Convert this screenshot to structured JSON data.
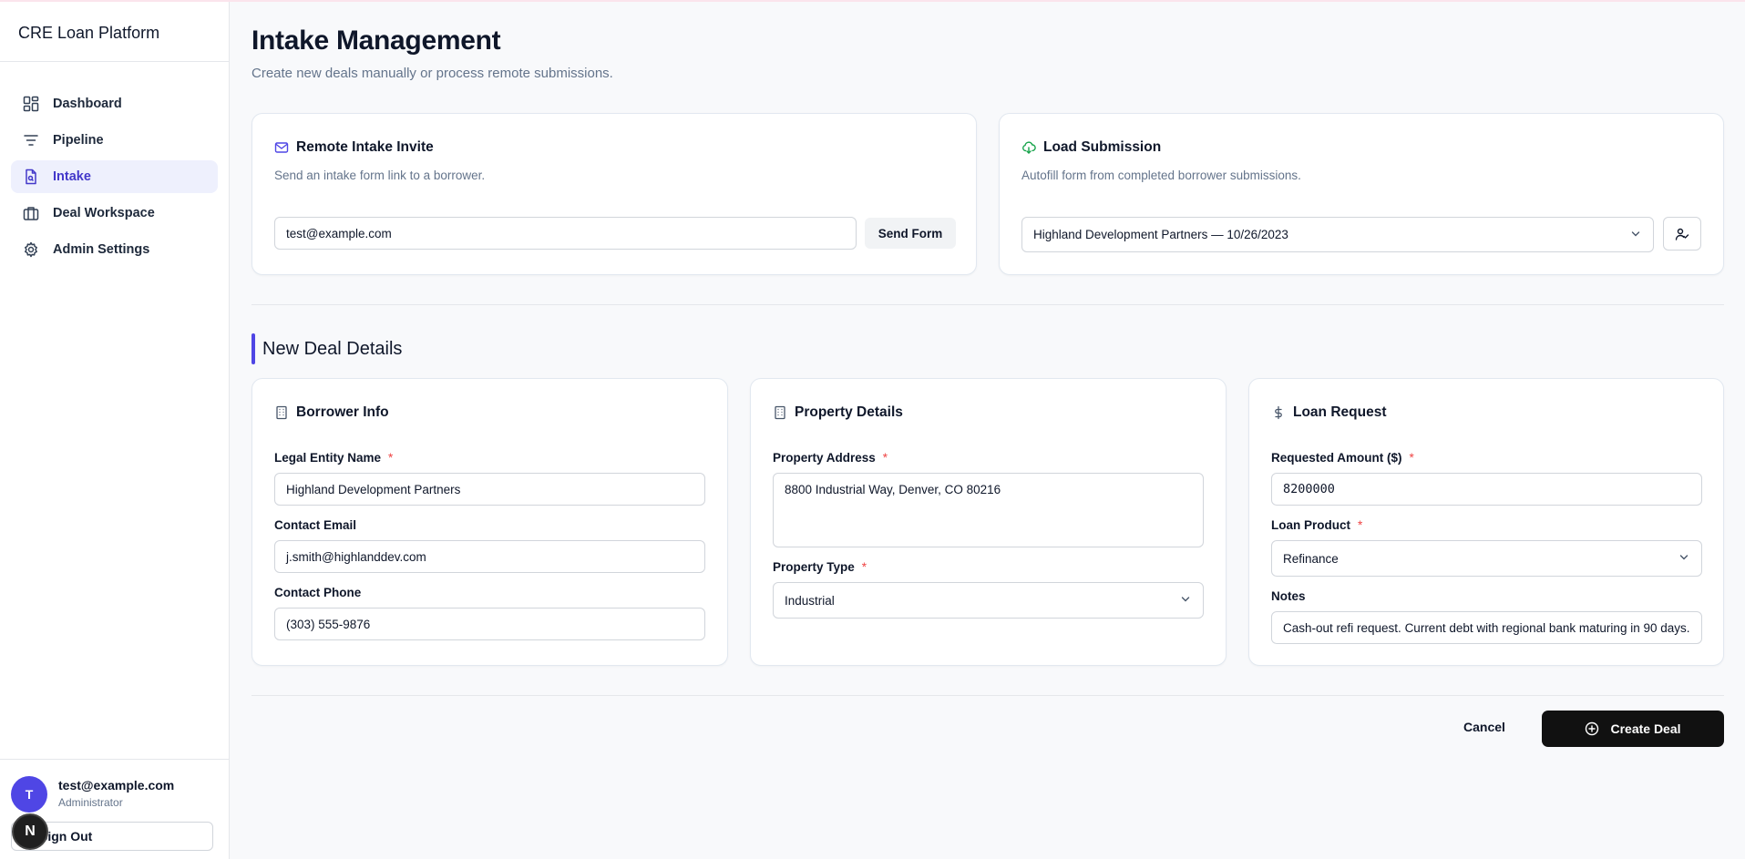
{
  "app": {
    "name": "CRE Loan Platform"
  },
  "sidebar": {
    "items": [
      {
        "label": "Dashboard",
        "icon": "dashboard-icon",
        "active": false
      },
      {
        "label": "Pipeline",
        "icon": "filter-icon",
        "active": false
      },
      {
        "label": "Intake",
        "icon": "file-search-icon",
        "active": true
      },
      {
        "label": "Deal Workspace",
        "icon": "briefcase-icon",
        "active": false
      },
      {
        "label": "Admin Settings",
        "icon": "gear-icon",
        "active": false
      }
    ],
    "user": {
      "initial": "T",
      "email": "test@example.com",
      "role": "Administrator"
    },
    "signout_label": "Sign Out"
  },
  "page": {
    "title": "Intake Management",
    "subtitle": "Create new deals manually or process remote submissions."
  },
  "remote_invite": {
    "title": "Remote Intake Invite",
    "description": "Send an intake form link to a borrower.",
    "email_value": "test@example.com",
    "send_label": "Send Form"
  },
  "load_submission": {
    "title": "Load Submission",
    "description": "Autofill form from completed borrower submissions.",
    "selected": "Highland Development Partners — 10/26/2023"
  },
  "new_deal": {
    "section_title": "New Deal Details",
    "borrower": {
      "title": "Borrower Info",
      "legal_entity_label": "Legal Entity Name",
      "legal_entity_value": "Highland Development Partners",
      "email_label": "Contact Email",
      "email_value": "j.smith@highlanddev.com",
      "phone_label": "Contact Phone",
      "phone_value": "(303) 555-9876"
    },
    "property": {
      "title": "Property Details",
      "address_label": "Property Address",
      "address_value": "8800 Industrial Way, Denver, CO 80216",
      "type_label": "Property Type",
      "type_value": "Industrial"
    },
    "loan": {
      "title": "Loan Request",
      "amount_label": "Requested Amount ($)",
      "amount_value": "8200000",
      "product_label": "Loan Product",
      "product_value": "Refinance",
      "notes_label": "Notes",
      "notes_value": "Cash-out refi request. Current debt with regional bank maturing in 90 days."
    },
    "required_marker": "*"
  },
  "actions": {
    "cancel_label": "Cancel",
    "create_label": "Create Deal"
  },
  "colors": {
    "accent": "#4f46e5",
    "active_bg": "#eef0fd",
    "required": "#ef4444",
    "primary_button": "#111111",
    "cloud_icon": "#16a34a"
  }
}
